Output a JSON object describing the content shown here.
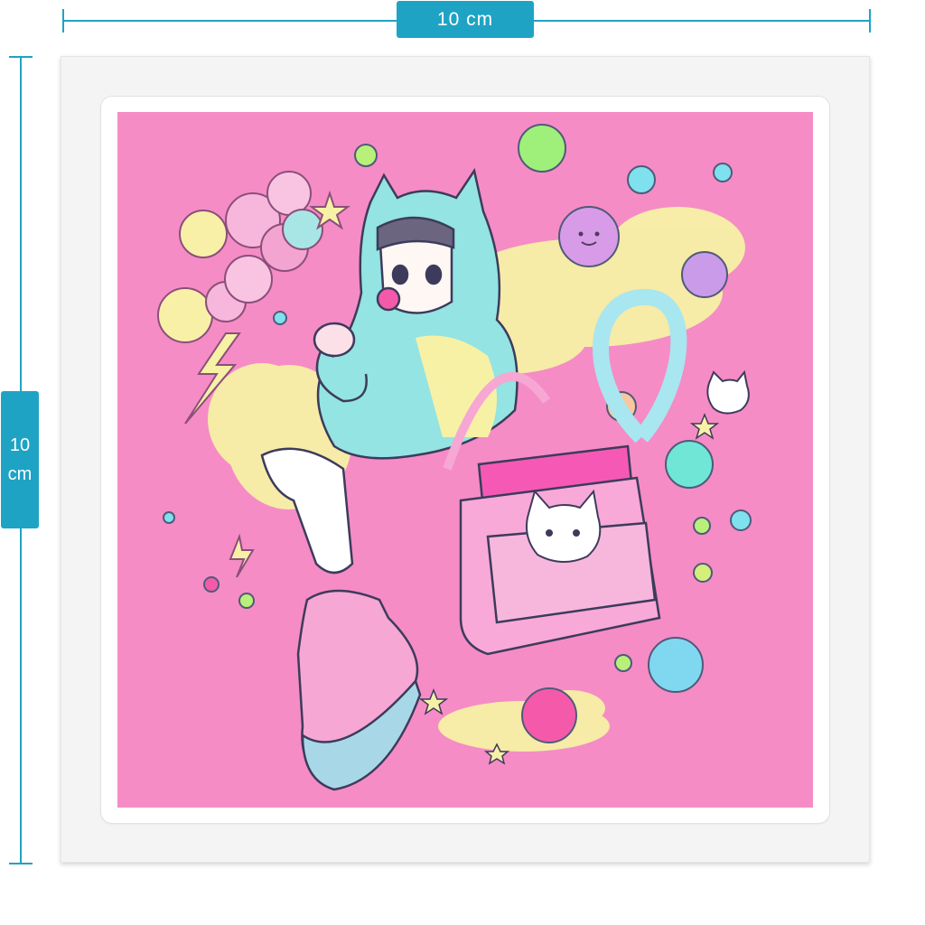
{
  "dimensions": {
    "width_label": "10 cm",
    "height_value": "10",
    "height_unit": "cm"
  },
  "artwork": {
    "subject": "sticker-illustration",
    "palette": {
      "background": "#f58cc5",
      "accent_guides": "#1fa3c4",
      "hoodie": "#93e4e2",
      "cream": "#f7f1a6",
      "pink": "#f6a7d3"
    }
  }
}
